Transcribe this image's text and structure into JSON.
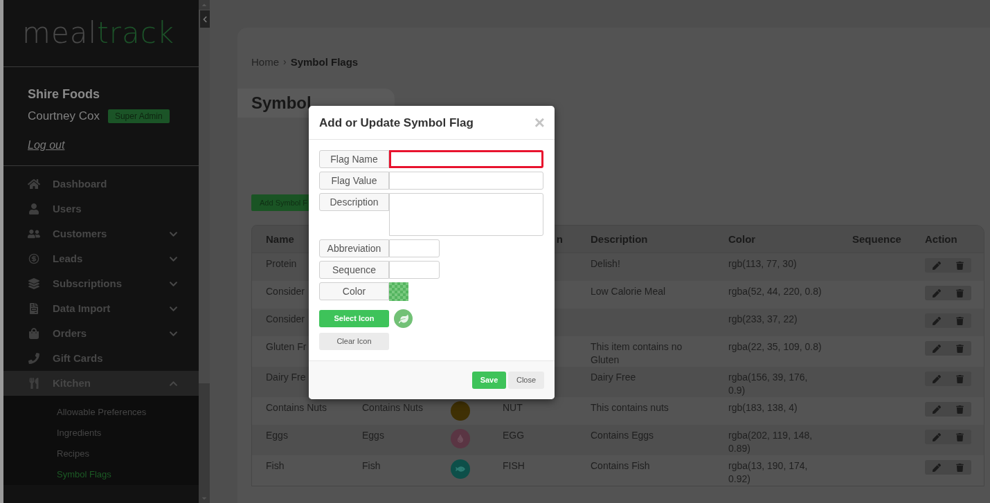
{
  "sidebar": {
    "logo": {
      "part_1": "meal",
      "part_2": "track"
    },
    "profile": {
      "company": "Shire Foods",
      "user": "Courtney Cox",
      "role_badge": "Super Admin",
      "logout": "Log out"
    },
    "items": [
      {
        "label": "Dashboard",
        "kind": "home",
        "selected": false
      },
      {
        "label": "Users",
        "kind": "user",
        "selected": false
      },
      {
        "label": "Customers",
        "kind": "users",
        "selected": false,
        "expanded": false
      },
      {
        "label": "Leads",
        "kind": "dollar",
        "selected": false,
        "expanded": false
      },
      {
        "label": "Subscriptions",
        "kind": "layers",
        "selected": false,
        "expanded": false
      },
      {
        "label": "Data Import",
        "kind": "file",
        "selected": false,
        "expanded": false
      },
      {
        "label": "Orders",
        "kind": "bag",
        "selected": false,
        "expanded": false
      },
      {
        "label": "Gift Cards",
        "kind": "phone",
        "selected": false
      },
      {
        "label": "Kitchen",
        "kind": "utensils",
        "selected": true,
        "expanded": true,
        "children": [
          {
            "label": "Allowable Preferences",
            "selected": false
          },
          {
            "label": "Ingredients",
            "selected": false
          },
          {
            "label": "Recipes",
            "selected": false
          },
          {
            "label": "Symbol Flags",
            "selected": true
          }
        ]
      }
    ]
  },
  "breadcrumb": [
    "Home",
    "›",
    "Symbol Flags"
  ],
  "page_title": "Symbol",
  "add_button": "Add Symbol F",
  "table": {
    "columns": [
      {
        "label": "Name"
      },
      {},
      {},
      {
        "label": "n"
      },
      {
        "label": "Description"
      },
      {
        "label": "Color"
      },
      {
        "label": "Sequence"
      },
      {
        "label": "Action"
      }
    ],
    "rows": [
      {
        "name": "Protein",
        "description": "Delish!",
        "color_value": "rgb(113, 77, 30)"
      },
      {
        "name": "Consider",
        "description": "Low Calorie Meal",
        "color_value": "rgba(52, 44, 220, 0.8)"
      },
      {
        "name": "Consider",
        "color_value": "rgb(233, 37, 22)"
      },
      {
        "name": "Gluten Fr",
        "description": "This item contains no Gluten",
        "color_value": "rgba(22, 35, 109, 0.8)"
      },
      {
        "name": "Dairy Fre",
        "description": "Dairy Free",
        "color_value": "rgba(156, 39, 176, 0.9)"
      },
      {
        "name": "Contains Nuts",
        "value": "Contains Nuts",
        "symbol": {
          "kind": "plain",
          "color": "#3f3004"
        },
        "abbreviation": "NUT",
        "description": "This contains nuts",
        "color_value": "rgb(183, 138, 4)"
      },
      {
        "name": "Eggs",
        "value": "Eggs",
        "symbol": {
          "kind": "drop",
          "color": "#5a3543"
        },
        "abbreviation": "EGG",
        "description": "Contains Eggs",
        "color_value": "rgba(202, 119, 148, 0.89)"
      },
      {
        "name": "Fish",
        "value": "Fish",
        "symbol": {
          "kind": "fish",
          "color": "#0d4f49"
        },
        "abbreviation": "FISH",
        "description": "Contains Fish",
        "color_value": "rgba(13, 190, 174, 0.92)"
      }
    ]
  },
  "modal": {
    "title": "Add or Update Symbol Flag",
    "close": "×",
    "fields": [
      {
        "kind": "text",
        "label": "Flag Name",
        "error": true
      },
      {
        "kind": "text",
        "label": "Flag Value",
        "error": false
      },
      {
        "kind": "textarea",
        "label": "Description",
        "error": false
      },
      {
        "kind": "short",
        "label": "Abbreviation",
        "error": false
      },
      {
        "kind": "short",
        "label": "Sequence",
        "error": false
      },
      {
        "kind": "color",
        "label": "Color",
        "error": false
      }
    ],
    "select_icon": "Select Icon",
    "clear_icon": "Clear Icon",
    "save": "Save",
    "close_button": "Close"
  }
}
